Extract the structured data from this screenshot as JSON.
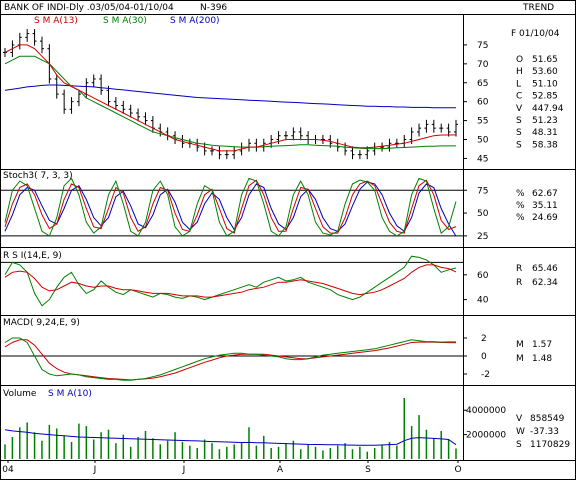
{
  "header": {
    "title": "BANK OF INDI-Dly .03/05/04-01/10/04",
    "count": "N-396",
    "trend_label": "TREND",
    "legend": [
      {
        "label": "S M A(13)",
        "color": "#d00000"
      },
      {
        "label": "S M A(30)",
        "color": "#008000"
      },
      {
        "label": "S M A(200)",
        "color": "#0000c0"
      }
    ]
  },
  "side_panel": {
    "date_label": "F 01/10/04",
    "rows": [
      {
        "key": "O",
        "value": "51.65",
        "color": "#000000"
      },
      {
        "key": "H",
        "value": "53.60",
        "color": "#808000"
      },
      {
        "key": "L",
        "value": "51.10",
        "color": "#808000"
      },
      {
        "key": "C",
        "value": "52.85",
        "color": "#808000"
      },
      {
        "key": "V",
        "value": "447.94",
        "color": "#000000"
      },
      {
        "key": "S",
        "value": "51.23",
        "color": "#d00000"
      },
      {
        "key": "S",
        "value": "48.31",
        "color": "#008000"
      },
      {
        "key": "S",
        "value": "58.38",
        "color": "#0000c0"
      }
    ]
  },
  "panels": {
    "stoch": {
      "label": "Stoch3( 7, 3, 3)",
      "values": [
        {
          "key": "%",
          "value": "62.67",
          "color": "#008000"
        },
        {
          "key": "%",
          "value": "35.11",
          "color": "#d00000"
        },
        {
          "key": "%",
          "value": "24.69",
          "color": "#0000c0"
        }
      ]
    },
    "rsi": {
      "label": "R S I(14,E, 9)",
      "values": [
        {
          "key": "R",
          "value": "65.46",
          "color": "#008000"
        },
        {
          "key": "R",
          "value": "62.34",
          "color": "#d00000"
        }
      ]
    },
    "macd": {
      "label": "MACD( 9,24,E, 9)",
      "values": [
        {
          "key": "M",
          "value": "1.57",
          "color": "#008000"
        },
        {
          "key": "M",
          "value": "1.48",
          "color": "#d00000"
        }
      ]
    },
    "volume": {
      "label": "Volume",
      "sma_label": "S M A(10)",
      "values": [
        {
          "key": "V",
          "value": "858549",
          "color": "#000000"
        },
        {
          "key": "W",
          "value": "-37.33",
          "color": "#000000"
        },
        {
          "key": "S",
          "value": "1170829",
          "color": "#0000c0"
        }
      ]
    }
  },
  "x_axis": {
    "labels": [
      "04",
      "J",
      "J",
      "A",
      "S",
      "O"
    ]
  },
  "chart_data": [
    {
      "type": "line",
      "name": "price",
      "ylim": [
        43,
        80
      ],
      "yticks": [
        45,
        50,
        55,
        60,
        65,
        70,
        75
      ],
      "close": [
        73,
        75,
        77,
        78,
        76,
        74,
        66,
        62,
        58,
        60,
        62,
        65,
        66,
        63,
        60,
        59,
        58,
        57,
        56,
        55,
        53,
        52,
        51,
        50,
        49,
        49,
        48,
        47,
        47,
        46,
        46,
        47,
        48,
        49,
        48,
        49,
        50,
        51,
        51,
        52,
        51,
        50,
        50,
        50,
        49,
        48,
        47,
        46,
        46,
        47,
        48,
        48,
        49,
        49,
        50,
        52,
        53,
        54,
        53,
        53,
        52,
        54
      ],
      "sma13": [
        73,
        74,
        75,
        75,
        74,
        72,
        70,
        67,
        65,
        64,
        63,
        62,
        61,
        60,
        59,
        58,
        57,
        56,
        55,
        54,
        53,
        52,
        51,
        50,
        49.5,
        49,
        48.5,
        48,
        47.5,
        47,
        47,
        47,
        47.5,
        48,
        48,
        48.5,
        49,
        49.5,
        50,
        50,
        50,
        50,
        50,
        49.8,
        49.5,
        49,
        48.5,
        48,
        47.8,
        47.8,
        48,
        48.2,
        48.5,
        48.8,
        49,
        49.5,
        50,
        50.5,
        51,
        51.2,
        51.2,
        51.23
      ],
      "sma30": [
        70,
        71,
        72,
        72,
        72,
        71,
        70,
        68,
        66,
        64,
        63,
        61,
        60,
        59,
        58,
        57,
        56,
        55,
        54,
        53,
        52,
        51.5,
        51,
        50.5,
        50,
        49.5,
        49,
        48.8,
        48.5,
        48.3,
        48.2,
        48.1,
        48,
        48,
        48,
        48.1,
        48.2,
        48.3,
        48.4,
        48.5,
        48.6,
        48.6,
        48.5,
        48.4,
        48.3,
        48.2,
        48,
        47.8,
        47.7,
        47.6,
        47.6,
        47.6,
        47.7,
        47.8,
        47.9,
        48,
        48.1,
        48.2,
        48.2,
        48.3,
        48.3,
        48.31
      ],
      "sma200": [
        63,
        63.3,
        63.6,
        63.9,
        64.1,
        64.3,
        64.4,
        64.4,
        64.3,
        64.2,
        64.1,
        64,
        63.9,
        63.7,
        63.5,
        63.3,
        63.1,
        62.9,
        62.7,
        62.5,
        62.3,
        62.1,
        61.9,
        61.7,
        61.5,
        61.3,
        61.1,
        61,
        60.9,
        60.8,
        60.7,
        60.6,
        60.5,
        60.4,
        60.3,
        60.2,
        60.1,
        60,
        59.9,
        59.8,
        59.7,
        59.6,
        59.5,
        59.4,
        59.3,
        59.2,
        59.1,
        59,
        58.9,
        58.8,
        58.8,
        58.7,
        58.7,
        58.6,
        58.6,
        58.5,
        58.5,
        58.5,
        58.4,
        58.4,
        58.4,
        58.38
      ]
    },
    {
      "type": "line",
      "name": "stochastic",
      "ylim": [
        15,
        95
      ],
      "yticks": [
        25,
        50,
        75
      ],
      "k": [
        40,
        75,
        85,
        80,
        55,
        30,
        25,
        45,
        80,
        88,
        70,
        40,
        28,
        35,
        70,
        85,
        60,
        30,
        25,
        40,
        75,
        85,
        70,
        35,
        25,
        30,
        60,
        80,
        75,
        40,
        25,
        30,
        70,
        88,
        85,
        60,
        30,
        25,
        35,
        70,
        85,
        70,
        40,
        28,
        26,
        30,
        60,
        82,
        86,
        84,
        75,
        45,
        30,
        25,
        30,
        70,
        88,
        85,
        55,
        28,
        35,
        62.67
      ],
      "d": [
        35,
        60,
        78,
        82,
        70,
        48,
        33,
        38,
        65,
        82,
        78,
        55,
        35,
        33,
        55,
        78,
        72,
        45,
        30,
        35,
        60,
        78,
        75,
        50,
        32,
        30,
        48,
        70,
        76,
        55,
        33,
        28,
        55,
        80,
        86,
        70,
        45,
        30,
        30,
        55,
        78,
        76,
        55,
        35,
        28,
        28,
        45,
        70,
        82,
        85,
        80,
        60,
        40,
        30,
        28,
        55,
        80,
        86,
        70,
        42,
        32,
        35.11
      ],
      "dd": [
        30,
        48,
        70,
        78,
        75,
        58,
        42,
        38,
        55,
        75,
        80,
        65,
        45,
        36,
        45,
        68,
        74,
        58,
        38,
        34,
        48,
        70,
        76,
        62,
        40,
        32,
        40,
        60,
        72,
        65,
        45,
        32,
        45,
        70,
        82,
        78,
        55,
        38,
        32,
        45,
        68,
        76,
        65,
        45,
        33,
        30,
        38,
        58,
        76,
        84,
        82,
        70,
        50,
        36,
        30,
        45,
        72,
        82,
        78,
        55,
        38,
        24.69
      ]
    },
    {
      "type": "line",
      "name": "rsi",
      "ylim": [
        30,
        80
      ],
      "yticks": [
        40,
        60
      ],
      "rsi": [
        60,
        70,
        68,
        62,
        45,
        35,
        40,
        50,
        58,
        62,
        52,
        45,
        48,
        55,
        50,
        46,
        44,
        48,
        46,
        44,
        42,
        45,
        44,
        42,
        41,
        43,
        42,
        40,
        42,
        44,
        46,
        48,
        50,
        52,
        50,
        54,
        56,
        58,
        55,
        56,
        58,
        54,
        52,
        50,
        48,
        44,
        42,
        40,
        42,
        46,
        50,
        54,
        58,
        62,
        66,
        75,
        74,
        72,
        68,
        62,
        64,
        65.46
      ],
      "signal": [
        58,
        62,
        63,
        62,
        57,
        50,
        47,
        48,
        51,
        54,
        53,
        51,
        50,
        51,
        51,
        49,
        48,
        48,
        47,
        46,
        45,
        45,
        45,
        44,
        43,
        43,
        43,
        42,
        42,
        43,
        44,
        45,
        46,
        48,
        49,
        50,
        52,
        54,
        54,
        55,
        56,
        55,
        54,
        53,
        51,
        49,
        47,
        45,
        44,
        45,
        46,
        48,
        51,
        54,
        57,
        62,
        66,
        68,
        68,
        66,
        65,
        62.34
      ]
    },
    {
      "type": "line",
      "name": "macd",
      "ylim": [
        -3,
        3
      ],
      "yticks": [
        -2,
        0,
        2
      ],
      "macd": [
        1.5,
        2,
        2,
        1.5,
        0,
        -1.5,
        -2,
        -2.2,
        -2.1,
        -2,
        -2.1,
        -2.3,
        -2.4,
        -2.5,
        -2.6,
        -2.6,
        -2.7,
        -2.7,
        -2.6,
        -2.5,
        -2.3,
        -2.1,
        -1.8,
        -1.5,
        -1.2,
        -0.9,
        -0.6,
        -0.3,
        -0.1,
        0.1,
        0.2,
        0.3,
        0.3,
        0.2,
        0.2,
        0.1,
        0,
        -0.1,
        -0.3,
        -0.4,
        -0.4,
        -0.3,
        -0.1,
        0.1,
        0.2,
        0.3,
        0.4,
        0.5,
        0.6,
        0.7,
        0.8,
        1,
        1.2,
        1.4,
        1.6,
        1.8,
        1.7,
        1.6,
        1.6,
        1.55,
        1.57,
        1.57
      ],
      "signal": [
        1,
        1.5,
        1.8,
        1.8,
        1.2,
        0.2,
        -0.8,
        -1.4,
        -1.8,
        -2,
        -2.1,
        -2.2,
        -2.3,
        -2.4,
        -2.5,
        -2.55,
        -2.6,
        -2.65,
        -2.6,
        -2.55,
        -2.45,
        -2.3,
        -2.1,
        -1.9,
        -1.6,
        -1.3,
        -1,
        -0.7,
        -0.45,
        -0.2,
        0,
        0.1,
        0.2,
        0.2,
        0.2,
        0.2,
        0.1,
        0,
        -0.1,
        -0.2,
        -0.3,
        -0.3,
        -0.2,
        -0.1,
        0,
        0.1,
        0.2,
        0.3,
        0.4,
        0.5,
        0.6,
        0.75,
        0.9,
        1.1,
        1.3,
        1.5,
        1.55,
        1.55,
        1.55,
        1.5,
        1.49,
        1.48
      ]
    },
    {
      "type": "bar",
      "name": "volume",
      "ylim": [
        0,
        5000000
      ],
      "yticks": [
        2000000,
        4000000
      ],
      "volumes": [
        1200000,
        1800000,
        2600000,
        3000000,
        2200000,
        1500000,
        2800000,
        2500000,
        1900000,
        1400000,
        2900000,
        2700000,
        1600000,
        2200000,
        2400000,
        1300000,
        2000000,
        1000000,
        1800000,
        2300000,
        1700000,
        1200000,
        1500000,
        2200000,
        1400000,
        1100000,
        900000,
        1600000,
        1300000,
        800000,
        1000000,
        1200000,
        1400000,
        2600000,
        1100000,
        1900000,
        900000,
        1000000,
        1300000,
        1500000,
        800000,
        1200000,
        1000000,
        700000,
        900000,
        1100000,
        1300000,
        800000,
        1000000,
        600000,
        900000,
        1200000,
        1400000,
        1100000,
        5000000,
        2700000,
        3600000,
        2400000,
        1700000,
        2300000,
        1600000,
        858549
      ],
      "sma": [
        2400000,
        2300000,
        2250000,
        2200000,
        2100000,
        2050000,
        2000000,
        1950000,
        1900000,
        1850000,
        1800000,
        1780000,
        1760000,
        1740000,
        1720000,
        1700000,
        1680000,
        1660000,
        1640000,
        1620000,
        1600000,
        1580000,
        1560000,
        1540000,
        1520000,
        1500000,
        1480000,
        1450000,
        1430000,
        1410000,
        1390000,
        1370000,
        1350000,
        1360000,
        1340000,
        1330000,
        1300000,
        1280000,
        1260000,
        1240000,
        1220000,
        1200000,
        1190000,
        1180000,
        1170000,
        1160000,
        1150000,
        1140000,
        1130000,
        1120000,
        1130000,
        1150000,
        1180000,
        1210000,
        1500000,
        1700000,
        1750000,
        1720000,
        1690000,
        1650000,
        1600000,
        1170829
      ]
    }
  ]
}
